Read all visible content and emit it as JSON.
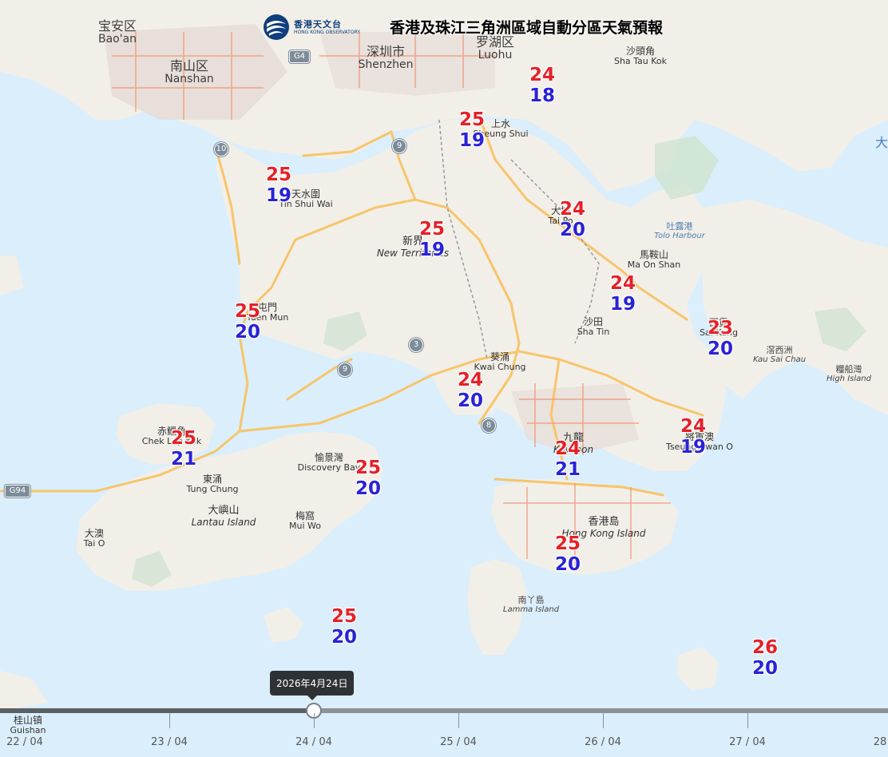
{
  "header": {
    "logo_zh": "香港天文台",
    "logo_en": "HONG KONG OBSERVATORY",
    "title": "香港及珠江三角洲區域自動分區天氣預報"
  },
  "map": {
    "colors": {
      "sea": "#dbeefb",
      "land": "#f2efe9",
      "road_major": "#f7c56a",
      "road_urban": "#f08a6a",
      "park": "#cfe3cf"
    },
    "places": [
      {
        "id": "baoan",
        "zh": "宝安区",
        "en": "Bao'an",
        "kind": "city"
      },
      {
        "id": "nanshan",
        "zh": "南山区",
        "en": "Nanshan",
        "kind": "city"
      },
      {
        "id": "shenzhen",
        "zh": "深圳市",
        "en": "Shenzhen",
        "kind": "city"
      },
      {
        "id": "luohu",
        "zh": "罗湖区",
        "en": "Luohu",
        "kind": "city"
      },
      {
        "id": "shataukok",
        "zh": "沙頭角",
        "en": "Sha Tau Kok",
        "kind": "town"
      },
      {
        "id": "sheungshui",
        "zh": "上水",
        "en": "Sheung Shui",
        "kind": "town"
      },
      {
        "id": "tinshuiwai",
        "zh": "天水圍",
        "en": "Tin Shui Wai",
        "kind": "town"
      },
      {
        "id": "newterritories",
        "zh": "新界",
        "en": "New Territories",
        "kind": "area"
      },
      {
        "id": "taipo",
        "zh": "大埔",
        "en": "Tai Po",
        "kind": "town"
      },
      {
        "id": "toloharbour",
        "zh": "吐露港",
        "en": "Tolo Harbour",
        "kind": "water"
      },
      {
        "id": "maonshan",
        "zh": "馬鞍山",
        "en": "Ma On Shan",
        "kind": "town"
      },
      {
        "id": "tuenmun",
        "zh": "屯門",
        "en": "Tuen Mun",
        "kind": "town"
      },
      {
        "id": "shatin",
        "zh": "沙田",
        "en": "Sha Tin",
        "kind": "town"
      },
      {
        "id": "saikung",
        "zh": "西貢",
        "en": "Sai Kung",
        "kind": "town"
      },
      {
        "id": "kausaichau",
        "zh": "滘西洲",
        "en": "Kau Sai Chau",
        "kind": "island"
      },
      {
        "id": "highisland",
        "zh": "糧船灣",
        "en": "High Island",
        "kind": "island"
      },
      {
        "id": "kwaichung",
        "zh": "葵涌",
        "en": "Kwai Chung",
        "kind": "town"
      },
      {
        "id": "chekLapKok",
        "zh": "赤鱲角",
        "en": "Chek Lap Kok",
        "kind": "town"
      },
      {
        "id": "discoverybay",
        "zh": "愉景灣",
        "en": "Discovery Bay",
        "kind": "town"
      },
      {
        "id": "kowloon",
        "zh": "九龍",
        "en": "Kowloon",
        "kind": "area"
      },
      {
        "id": "tseungkwano",
        "zh": "將軍澳",
        "en": "Tseung Kwan O",
        "kind": "town"
      },
      {
        "id": "tungchung",
        "zh": "東涌",
        "en": "Tung Chung",
        "kind": "town"
      },
      {
        "id": "lantau",
        "zh": "大嶼山",
        "en": "Lantau Island",
        "kind": "area"
      },
      {
        "id": "muiwo",
        "zh": "梅窩",
        "en": "Mui Wo",
        "kind": "town"
      },
      {
        "id": "taio",
        "zh": "大澳",
        "en": "Tai O",
        "kind": "town"
      },
      {
        "id": "hongkongisland",
        "zh": "香港島",
        "en": "Hong Kong Island",
        "kind": "area"
      },
      {
        "id": "lamma",
        "zh": "南丫島",
        "en": "Lamma Island",
        "kind": "island"
      },
      {
        "id": "guishan",
        "zh": "桂山镇",
        "en": "Guishan",
        "kind": "town"
      },
      {
        "id": "edge-da",
        "zh": "大",
        "en": "",
        "kind": "water"
      }
    ],
    "route_shields": [
      "G4",
      "10",
      "9",
      "3",
      "9",
      "8",
      "G94"
    ],
    "stations": [
      {
        "id": "shataukok",
        "max": "24",
        "min": "18"
      },
      {
        "id": "sheungshui",
        "max": "25",
        "min": "19"
      },
      {
        "id": "tinshuiwai",
        "max": "25",
        "min": "19"
      },
      {
        "id": "newterritories",
        "max": "25",
        "min": "19"
      },
      {
        "id": "taipo",
        "max": "24",
        "min": "20"
      },
      {
        "id": "maonshan",
        "max": "24",
        "min": "19"
      },
      {
        "id": "tuenmun",
        "max": "25",
        "min": "20"
      },
      {
        "id": "saikung",
        "max": "23",
        "min": "20"
      },
      {
        "id": "kwaichung",
        "max": "24",
        "min": "20"
      },
      {
        "id": "tseungkwano",
        "max": "24",
        "min": "19"
      },
      {
        "id": "chekLapKok",
        "max": "25",
        "min": "21"
      },
      {
        "id": "discoverybay",
        "max": "25",
        "min": "20"
      },
      {
        "id": "kowloon",
        "max": "24",
        "min": "21"
      },
      {
        "id": "hongkongisland",
        "max": "25",
        "min": "20"
      },
      {
        "id": "southsea",
        "max": "25",
        "min": "20"
      },
      {
        "id": "eastsea",
        "max": "26",
        "min": "20"
      }
    ]
  },
  "timeline": {
    "tooltip": "2026年4月24日",
    "ticks": [
      "22 / 04",
      "23 / 04",
      "24 / 04",
      "25 / 04",
      "26 / 04",
      "27 / 04",
      "28"
    ],
    "selected_index": 2,
    "progress": 0.354
  }
}
